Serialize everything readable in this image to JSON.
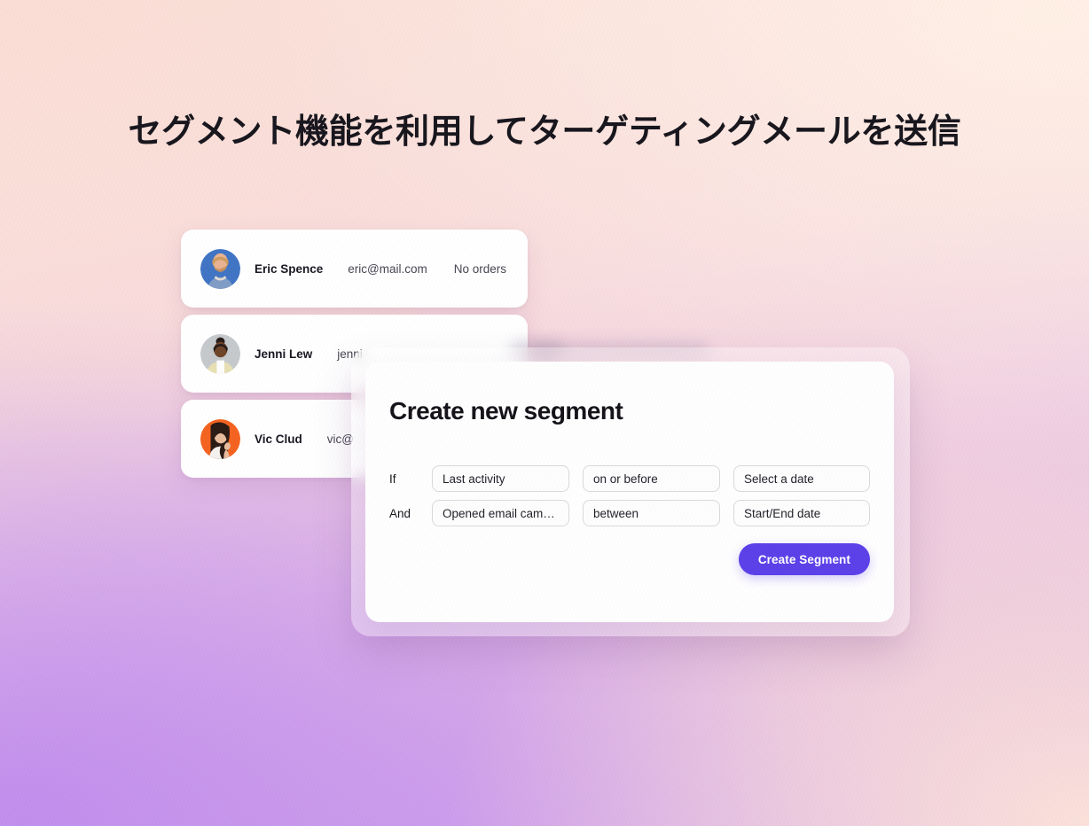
{
  "page": {
    "headline": "セグメント機能を利用してターゲティングメールを送信",
    "background_colors": {
      "pink_top_left": "#FADED6",
      "cream_top_right": "#FFF0E6",
      "lavender_bottom_left": "#BF8CEC",
      "lilac_bottom_center": "#D0A2ED",
      "pink_bottom_right": "#FBE1D9"
    }
  },
  "customer_list": {
    "rows": [
      {
        "avatar": "avatar-photo-man-blue",
        "name": "Eric Spence",
        "email": "eric@mail.com",
        "orders": "No orders"
      },
      {
        "avatar": "avatar-photo-woman-gray",
        "name": "Jenni Lew",
        "email": "jenni",
        "orders": ""
      },
      {
        "avatar": "avatar-photo-woman-orange",
        "name": "Vic Clud",
        "email": "vic@",
        "orders": ""
      }
    ]
  },
  "modal": {
    "title": "Create new segment",
    "rules": [
      {
        "conjunction": "If",
        "attribute": "Last activity",
        "operator": "on or before",
        "value": "Select a date"
      },
      {
        "conjunction": "And",
        "attribute": "Opened email cam…",
        "operator": "between",
        "value": "Start/End date"
      }
    ],
    "submit_label": "Create Segment",
    "submit_color": "#5B3FE8"
  }
}
